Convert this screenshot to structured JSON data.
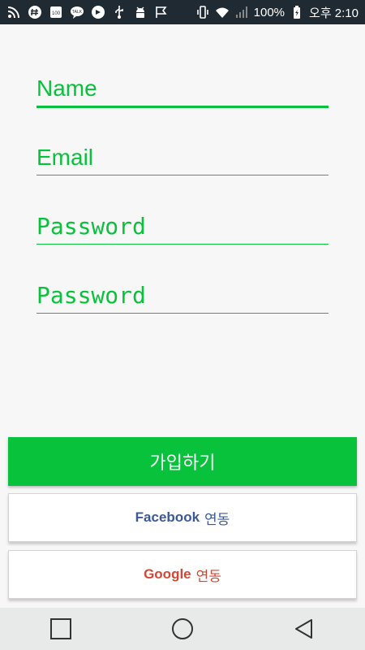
{
  "status_bar": {
    "battery": "100%",
    "time": "오후 2:10",
    "icons": [
      "rss-icon",
      "hashtag-icon",
      "badge-100-icon",
      "kakaotalk-icon",
      "app-icon",
      "usb-icon",
      "android-debug-icon",
      "check-flag-icon",
      "vibrate-icon",
      "wifi-icon",
      "signal-icon",
      "battery-icon"
    ]
  },
  "form": {
    "name_placeholder": "Name",
    "email_placeholder": "Email",
    "password_placeholder": "Password",
    "password_confirm_placeholder": "Password"
  },
  "buttons": {
    "signup_label": "가입하기",
    "facebook_brand": "Facebook",
    "facebook_suffix": "연동",
    "google_brand": "Google",
    "google_suffix": "연동"
  },
  "colors": {
    "accent": "#09c23c",
    "facebook": "#3b5998",
    "google": "#d14836",
    "status_bar": "#1f2a33"
  },
  "navbar": {
    "icons": [
      "recent-apps-icon",
      "home-icon",
      "back-icon"
    ]
  }
}
